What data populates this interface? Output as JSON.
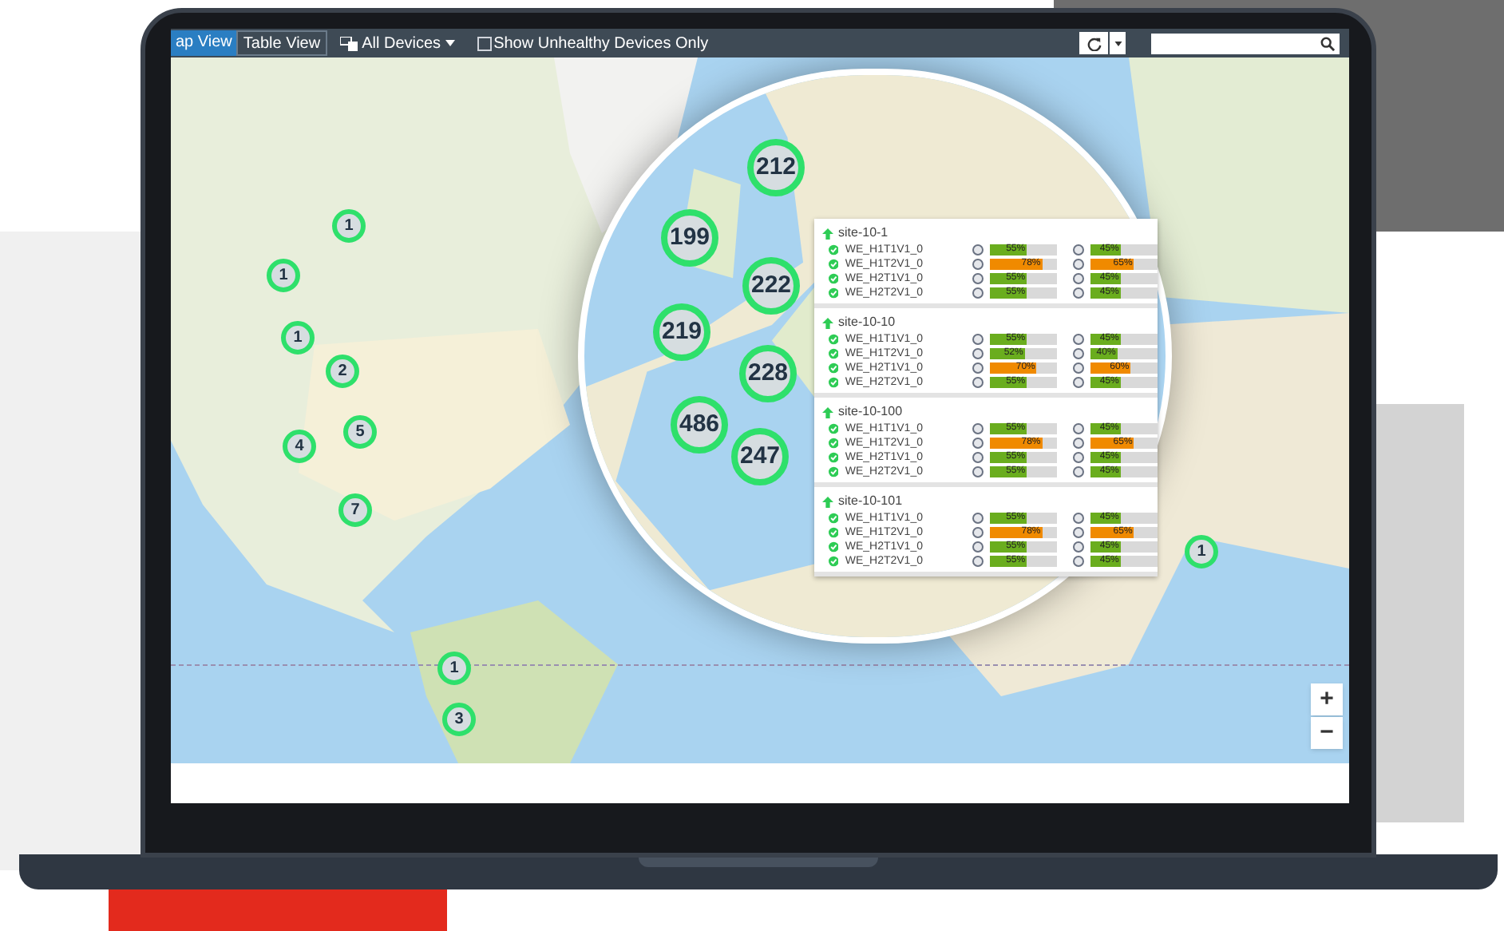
{
  "toolbar": {
    "views": [
      {
        "label": "ap View",
        "selected": true
      },
      {
        "label": "Table View",
        "selected": false
      }
    ],
    "device_filter": {
      "label": "All Devices"
    },
    "unhealthy_only": {
      "label": "Show Unhealthy Devices Only",
      "checked": false
    }
  },
  "map": {
    "clusters": [
      {
        "count": "1"
      },
      {
        "count": "1"
      },
      {
        "count": "1"
      },
      {
        "count": "2"
      },
      {
        "count": "4"
      },
      {
        "count": "5"
      },
      {
        "count": "7"
      },
      {
        "count": "1"
      },
      {
        "count": "3"
      },
      {
        "count": "1"
      }
    ],
    "magnifier": {
      "clusters": [
        {
          "count": "212"
        },
        {
          "count": "199"
        },
        {
          "count": "222"
        },
        {
          "count": "219"
        },
        {
          "count": "228"
        },
        {
          "count": "486"
        },
        {
          "count": "247"
        }
      ]
    },
    "site_panel": {
      "sites": [
        {
          "name": "site-10-1",
          "devices": [
            {
              "name": "WE_H1T1V1_0",
              "meters": [
                {
                  "level": 0.55,
                  "reading": "55%",
                  "color": "#6aad1e"
                },
                {
                  "level": 0.45,
                  "reading": "45%",
                  "color": "#6aad1e"
                }
              ]
            },
            {
              "name": "WE_H1T2V1_0",
              "meters": [
                {
                  "level": 0.78,
                  "reading": "78%",
                  "color": "#f08a00"
                },
                {
                  "level": 0.65,
                  "reading": "65%",
                  "color": "#f08a00"
                }
              ]
            },
            {
              "name": "WE_H2T1V1_0",
              "meters": [
                {
                  "level": 0.55,
                  "reading": "55%",
                  "color": "#6aad1e"
                },
                {
                  "level": 0.45,
                  "reading": "45%",
                  "color": "#6aad1e"
                }
              ]
            },
            {
              "name": "WE_H2T2V1_0",
              "meters": [
                {
                  "level": 0.55,
                  "reading": "55%",
                  "color": "#6aad1e"
                },
                {
                  "level": 0.45,
                  "reading": "45%",
                  "color": "#6aad1e"
                }
              ]
            }
          ]
        },
        {
          "name": "site-10-10",
          "devices": [
            {
              "name": "WE_H1T1V1_0",
              "meters": [
                {
                  "level": 0.55,
                  "reading": "55%",
                  "color": "#6aad1e"
                },
                {
                  "level": 0.45,
                  "reading": "45%",
                  "color": "#6aad1e"
                }
              ]
            },
            {
              "name": "WE_H1T2V1_0",
              "meters": [
                {
                  "level": 0.52,
                  "reading": "52%",
                  "color": "#6aad1e"
                },
                {
                  "level": 0.4,
                  "reading": "40%",
                  "color": "#6aad1e"
                }
              ]
            },
            {
              "name": "WE_H2T1V1_0",
              "meters": [
                {
                  "level": 0.7,
                  "reading": "70%",
                  "color": "#f08a00"
                },
                {
                  "level": 0.6,
                  "reading": "60%",
                  "color": "#f08a00"
                }
              ]
            },
            {
              "name": "WE_H2T2V1_0",
              "meters": [
                {
                  "level": 0.55,
                  "reading": "55%",
                  "color": "#6aad1e"
                },
                {
                  "level": 0.45,
                  "reading": "45%",
                  "color": "#6aad1e"
                }
              ]
            }
          ]
        },
        {
          "name": "site-10-100",
          "devices": [
            {
              "name": "WE_H1T1V1_0",
              "meters": [
                {
                  "level": 0.55,
                  "reading": "55%",
                  "color": "#6aad1e"
                },
                {
                  "level": 0.45,
                  "reading": "45%",
                  "color": "#6aad1e"
                }
              ]
            },
            {
              "name": "WE_H1T2V1_0",
              "meters": [
                {
                  "level": 0.78,
                  "reading": "78%",
                  "color": "#f08a00"
                },
                {
                  "level": 0.65,
                  "reading": "65%",
                  "color": "#f08a00"
                }
              ]
            },
            {
              "name": "WE_H2T1V1_0",
              "meters": [
                {
                  "level": 0.55,
                  "reading": "55%",
                  "color": "#6aad1e"
                },
                {
                  "level": 0.45,
                  "reading": "45%",
                  "color": "#6aad1e"
                }
              ]
            },
            {
              "name": "WE_H2T2V1_0",
              "meters": [
                {
                  "level": 0.55,
                  "reading": "55%",
                  "color": "#6aad1e"
                },
                {
                  "level": 0.45,
                  "reading": "45%",
                  "color": "#6aad1e"
                }
              ]
            }
          ]
        },
        {
          "name": "site-10-101",
          "devices": [
            {
              "name": "WE_H1T1V1_0",
              "meters": [
                {
                  "level": 0.55,
                  "reading": "55%",
                  "color": "#6aad1e"
                },
                {
                  "level": 0.45,
                  "reading": "45%",
                  "color": "#6aad1e"
                }
              ]
            },
            {
              "name": "WE_H1T2V1_0",
              "meters": [
                {
                  "level": 0.78,
                  "reading": "78%",
                  "color": "#f08a00"
                },
                {
                  "level": 0.65,
                  "reading": "65%",
                  "color": "#f08a00"
                }
              ]
            },
            {
              "name": "WE_H2T1V1_0",
              "meters": [
                {
                  "level": 0.55,
                  "reading": "55%",
                  "color": "#6aad1e"
                },
                {
                  "level": 0.45,
                  "reading": "45%",
                  "color": "#6aad1e"
                }
              ]
            },
            {
              "name": "WE_H2T2V1_0",
              "meters": [
                {
                  "level": 0.55,
                  "reading": "55%",
                  "color": "#6aad1e"
                },
                {
                  "level": 0.45,
                  "reading": "45%",
                  "color": "#6aad1e"
                }
              ]
            }
          ]
        }
      ]
    },
    "zoom_controls": [
      {
        "label": "+"
      },
      {
        "label": "−"
      }
    ]
  }
}
